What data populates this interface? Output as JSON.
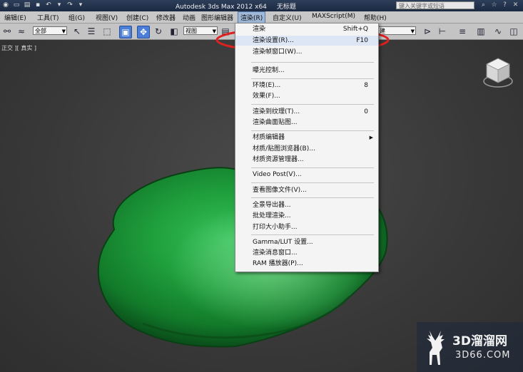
{
  "titlebar": {
    "app_title": "Autodesk 3ds Max  2012 x64",
    "doc_title": "无标题",
    "search_placeholder": "键入关键字或短语"
  },
  "menubar": {
    "items": [
      "编辑(E)",
      "工具(T)",
      "组(G)",
      "视图(V)",
      "创建(C)",
      "修改器",
      "动画",
      "图形编辑器",
      "渲染(R)",
      "自定义(U)",
      "MAXScript(M)",
      "帮助(H)"
    ]
  },
  "toolbar": {
    "selection_filter": "全部",
    "reference_coord": "视图",
    "named_selection": "建"
  },
  "viewport": {
    "label": "正交 ][ 真实 ]"
  },
  "render_menu": {
    "items": [
      {
        "label": "渲染",
        "shortcut": "Shift+Q"
      },
      {
        "label": "渲染设置(R)...",
        "shortcut": "F10"
      },
      {
        "label": "渲染帧窗口(W)...",
        "shortcut": ""
      },
      {
        "label": "曝光控制...",
        "shortcut": ""
      },
      {
        "label": "环境(E)...",
        "shortcut": "8"
      },
      {
        "label": "效果(F)...",
        "shortcut": ""
      },
      {
        "label": "渲染到纹理(T)...",
        "shortcut": "0"
      },
      {
        "label": "渲染曲面贴图...",
        "shortcut": ""
      },
      {
        "label": "材质编辑器",
        "shortcut": ""
      },
      {
        "label": "材质/贴图浏览器(B)...",
        "shortcut": ""
      },
      {
        "label": "材质资源管理器...",
        "shortcut": ""
      },
      {
        "label": "Video Post(V)...",
        "shortcut": ""
      },
      {
        "label": "查看图像文件(V)...",
        "shortcut": ""
      },
      {
        "label": "全景导出器...",
        "shortcut": ""
      },
      {
        "label": "批处理渲染...",
        "shortcut": ""
      },
      {
        "label": "打印大小助手...",
        "shortcut": ""
      },
      {
        "label": "Gamma/LUT 设置...",
        "shortcut": ""
      },
      {
        "label": "渲染消息窗口...",
        "shortcut": ""
      },
      {
        "label": "RAM 播放器(P)...",
        "shortcut": ""
      }
    ]
  },
  "watermark": {
    "brand": "3D溜溜网",
    "site": "3D66.COM"
  },
  "colors": {
    "highlight_ellipse": "#e02020",
    "stone_green": "#1f9e3c"
  }
}
